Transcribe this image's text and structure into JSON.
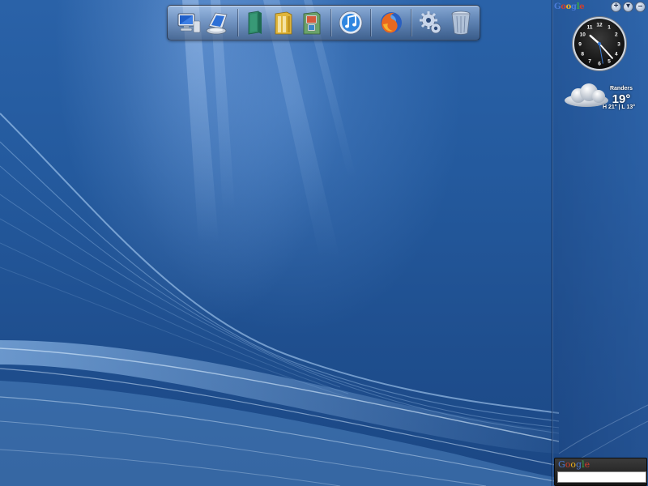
{
  "desktop": {
    "dock": {
      "items": [
        {
          "name": "computer",
          "icon": "computer-icon"
        },
        {
          "name": "network",
          "icon": "network-drive-icon"
        },
        {
          "name": "book",
          "icon": "book-icon"
        },
        {
          "name": "documents",
          "icon": "folder-icon"
        },
        {
          "name": "pictures",
          "icon": "picture-folder-icon"
        },
        {
          "name": "itunes",
          "icon": "music-note-icon"
        },
        {
          "name": "firefox",
          "icon": "firefox-icon"
        },
        {
          "name": "settings",
          "icon": "gears-icon"
        },
        {
          "name": "recycle-bin",
          "icon": "trash-icon"
        }
      ]
    }
  },
  "sidebar": {
    "logo": "Google",
    "controls": {
      "add": "+",
      "nav": "▾",
      "minimize": "–"
    },
    "clock": {
      "numerals": [
        "12",
        "1",
        "2",
        "3",
        "4",
        "5",
        "6",
        "7",
        "8",
        "9",
        "10",
        "11"
      ],
      "hour": 10,
      "minute": 23
    },
    "weather": {
      "city": "Randers",
      "temp": "19°",
      "range": "H 21° | L 13°",
      "icon": "cloud-icon"
    },
    "search": {
      "logo": "Google",
      "value": ""
    }
  },
  "colors": {
    "wallpaper": "#1f4f8f",
    "google": [
      "#4a7bd8",
      "#d33f2c",
      "#f2b51c",
      "#4a7bd8",
      "#3aa845",
      "#d33f2c"
    ]
  }
}
